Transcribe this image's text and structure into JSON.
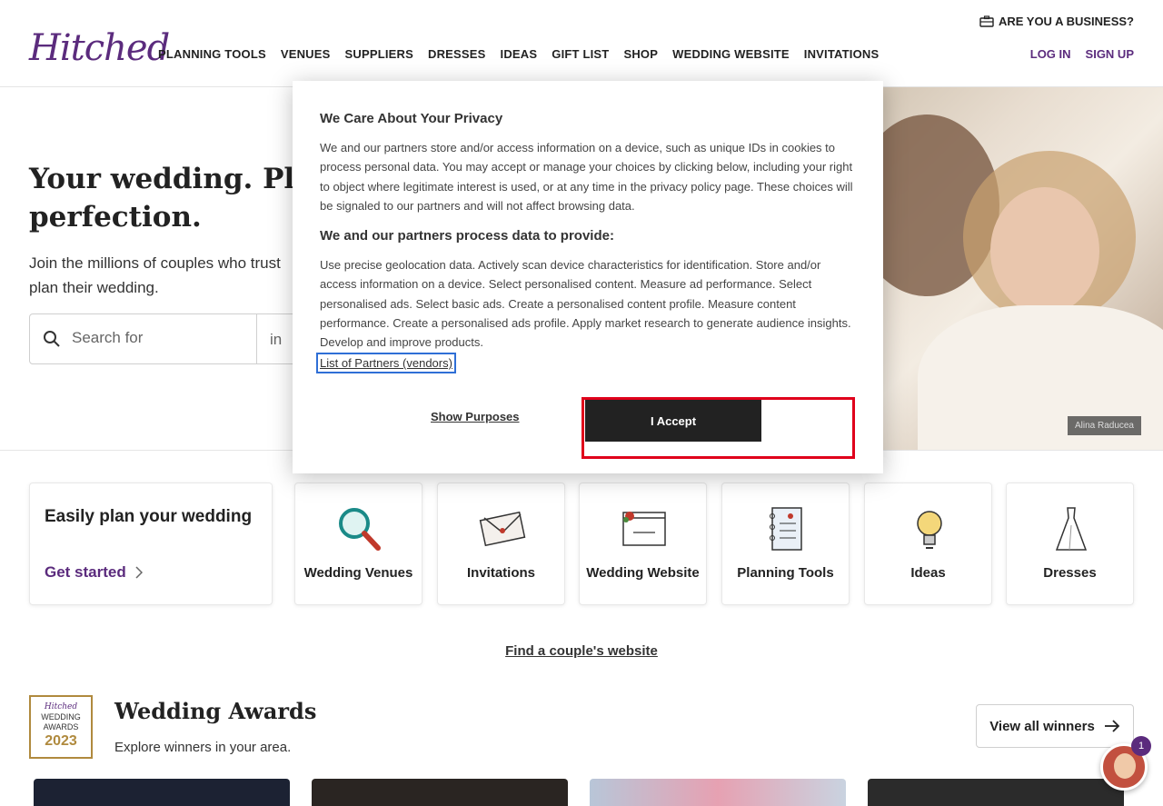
{
  "header": {
    "logo": "Hitched",
    "nav": [
      "PLANNING TOOLS",
      "VENUES",
      "SUPPLIERS",
      "DRESSES",
      "IDEAS",
      "GIFT LIST",
      "SHOP",
      "WEDDING WEBSITE",
      "INVITATIONS"
    ],
    "business_link": "ARE YOU A BUSINESS?",
    "login": "LOG IN",
    "signup": "SIGN UP"
  },
  "hero": {
    "title_line1": "Your wedding. Plan",
    "title_line2": "perfection.",
    "subtitle": "Join the millions of couples who trust",
    "subtitle_line2": "plan their wedding.",
    "search_placeholder": "Search for",
    "location_prefix": "in",
    "photo_credit": "Alina Raducea"
  },
  "cards": {
    "main_title": "Easily plan your wedding",
    "main_link": "Get started",
    "categories": [
      {
        "label": "Wedding Venues",
        "icon": "magnifier-icon"
      },
      {
        "label": "Invitations",
        "icon": "envelope-icon"
      },
      {
        "label": "Wedding Website",
        "icon": "website-icon"
      },
      {
        "label": "Planning Tools",
        "icon": "notebook-icon"
      },
      {
        "label": "Ideas",
        "icon": "lightbulb-icon"
      },
      {
        "label": "Dresses",
        "icon": "dress-icon"
      }
    ]
  },
  "couple_link": "Find a couple's website",
  "awards": {
    "badge_brand": "Hitched",
    "badge_line1": "WEDDING",
    "badge_line2": "AWARDS",
    "badge_year": "2023",
    "title": "Wedding Awards",
    "subtitle": "Explore winners in your area.",
    "view_all": "View all winners"
  },
  "chat": {
    "badge_count": "1"
  },
  "consent": {
    "title": "We Care About Your Privacy",
    "body": "We and our partners store and/or access information on a device, such as unique IDs in cookies to process personal data. You may accept or manage your choices by clicking below, including your right to object where legitimate interest is used, or at any time in the privacy policy page. These choices will be signaled to our partners and will not affect browsing data.",
    "purposes_title": "We and our partners process data to provide:",
    "purposes_body": "Use precise geolocation data. Actively scan device characteristics for identification. Store and/or access information on a device. Select personalised content. Measure ad performance. Select personalised ads. Select basic ads. Create a personalised content profile. Measure content performance. Create a personalised ads profile. Apply market research to generate audience insights. Develop and improve products.",
    "partners_link": "List of Partners (vendors)",
    "show_purposes": "Show Purposes",
    "accept": "I Accept"
  },
  "colors": {
    "brand": "#5b2b7d",
    "highlight": "#e0001b",
    "accept_bg": "#222222"
  }
}
